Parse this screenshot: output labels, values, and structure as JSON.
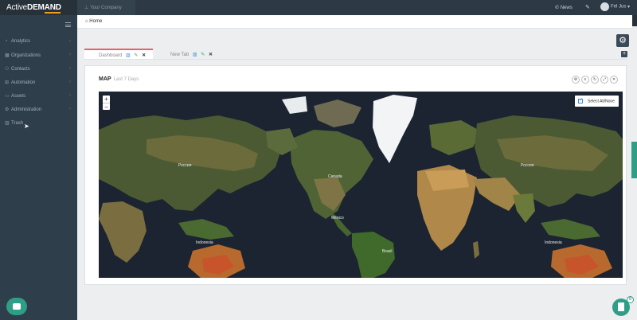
{
  "topbar": {
    "logo_part1": "Active",
    "logo_part2": "DEMAND",
    "company": "Your Company",
    "news": "News",
    "user": "Fel Jus"
  },
  "sidebar": {
    "items": [
      {
        "label": "Analytics",
        "icon": "chart-icon"
      },
      {
        "label": "Organizations",
        "icon": "building-icon"
      },
      {
        "label": "Contacts",
        "icon": "people-icon"
      },
      {
        "label": "Automation",
        "icon": "sitemap-icon"
      },
      {
        "label": "Assets",
        "icon": "folder-icon"
      },
      {
        "label": "Administration",
        "icon": "settings-icon"
      },
      {
        "label": "Trash",
        "icon": "trash-icon"
      }
    ]
  },
  "breadcrumb": {
    "home": "Home"
  },
  "tabs": [
    {
      "label": "Dashboard",
      "active": true
    },
    {
      "label": "New Tab",
      "active": false
    }
  ],
  "panel": {
    "title": "MAP",
    "subtitle": "Last 7 Days"
  },
  "map": {
    "zoom_in": "+",
    "zoom_out": "−",
    "select_all": "Select All/None",
    "labels": [
      {
        "text": "Россия"
      },
      {
        "text": "Canada"
      },
      {
        "text": "Россия"
      },
      {
        "text": "México"
      },
      {
        "text": "Brasil"
      },
      {
        "text": "Indonesia"
      },
      {
        "text": "Indonesia"
      }
    ]
  },
  "badge_count": "0",
  "colors": {
    "accent": "#2f9e87",
    "tab_active": "#e8606c",
    "sidebar": "#2f3e4b",
    "logo_underline": "#f29c1f"
  }
}
